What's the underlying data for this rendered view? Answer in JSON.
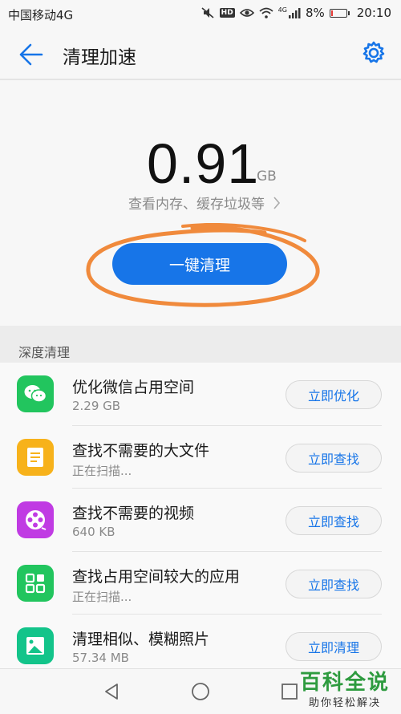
{
  "status_bar": {
    "carrier": "中国移动4G",
    "network_tag": "4G",
    "battery": "8%",
    "battery_level": 0.08,
    "time": "20:10",
    "icons": [
      "mute-icon",
      "hd-icon",
      "eye-icon",
      "wifi-icon",
      "signal-icon",
      "battery-icon"
    ]
  },
  "header": {
    "title": "清理加速",
    "back_icon": "arrow-left-icon",
    "settings_icon": "gear-icon"
  },
  "summary": {
    "value": "0.91",
    "unit": "GB",
    "detail_link": "查看内存、缓存垃圾等",
    "clean_button": "一键清理"
  },
  "deep_clean": {
    "section_title": "深度清理",
    "items": [
      {
        "icon": "wechat-icon",
        "color": "#22c55e",
        "title": "优化微信占用空间",
        "subtitle": "2.29 GB",
        "action": "立即优化"
      },
      {
        "icon": "document-icon",
        "color": "#f7b21b",
        "title": "查找不需要的大文件",
        "subtitle": "正在扫描...",
        "action": "立即查找"
      },
      {
        "icon": "video-reel-icon",
        "color": "#c03be3",
        "title": "查找不需要的视频",
        "subtitle": "640 KB",
        "action": "立即查找"
      },
      {
        "icon": "apps-grid-icon",
        "color": "#22c55e",
        "title": "查找占用空间较大的应用",
        "subtitle": "正在扫描...",
        "action": "立即查找"
      },
      {
        "icon": "photo-icon",
        "color": "#13c48a",
        "title": "清理相似、模糊照片",
        "subtitle": "57.34 MB",
        "action": "立即清理"
      }
    ]
  },
  "nav_bar": {
    "icons": [
      "nav-back-icon",
      "nav-home-icon",
      "nav-recent-icon"
    ]
  },
  "watermark": {
    "title": "百科全说",
    "subtitle": "助你轻松解决"
  },
  "colors": {
    "accent": "#1775e8",
    "annotation": "#f08a3c",
    "background": "#f7f7f7"
  }
}
